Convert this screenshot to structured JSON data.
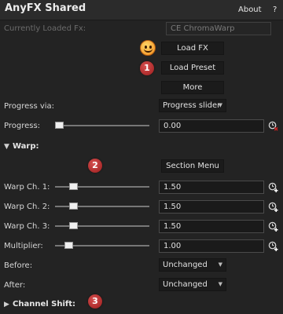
{
  "app": {
    "title": "AnyFX Shared"
  },
  "header": {
    "about_label": "About",
    "help_label": "?"
  },
  "loaded_fx": {
    "label": "Currently Loaded Fx:",
    "value": "CE ChromaWarp"
  },
  "buttons": {
    "load_fx": "Load FX",
    "load_preset": "Load Preset",
    "more": "More",
    "section_menu": "Section Menu"
  },
  "progress_via": {
    "label": "Progress via:",
    "selected": "Progress slider"
  },
  "progress": {
    "label": "Progress:",
    "value": "0.00",
    "slider_fraction": 0.0
  },
  "warp_section": {
    "title": "Warp:",
    "expanded": true
  },
  "warp_params": [
    {
      "label": "Warp Ch. 1:",
      "value": "1.50",
      "slider_fraction": 0.15
    },
    {
      "label": "Warp Ch. 2:",
      "value": "1.50",
      "slider_fraction": 0.15
    },
    {
      "label": "Warp Ch. 3:",
      "value": "1.50",
      "slider_fraction": 0.15
    },
    {
      "label": "Multiplier:",
      "value": "1.00",
      "slider_fraction": 0.1
    }
  ],
  "before": {
    "label": "Before:",
    "selected": "Unchanged"
  },
  "after": {
    "label": "After:",
    "selected": "Unchanged"
  },
  "channel_shift_section": {
    "title": "Channel Shift:",
    "expanded": false
  },
  "callouts": [
    "1",
    "2",
    "3"
  ],
  "colors": {
    "background": "#232323",
    "callout": "#b42a2a",
    "clock_accent_red": "#cc2222",
    "clock_accent_white": "#ffffff"
  }
}
